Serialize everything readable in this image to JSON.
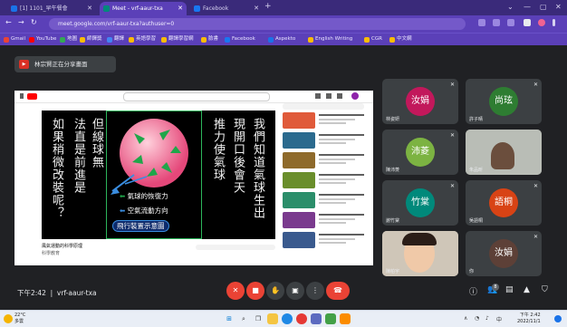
{
  "browser": {
    "tabs": [
      {
        "label": "[1] 1101_早午餐會",
        "active": false
      },
      {
        "label": "Meet - vrf-aaur-txa",
        "active": true
      },
      {
        "label": "Facebook",
        "active": false
      }
    ],
    "url": "meet.google.com/vrf-aaur-txa?authuser=0",
    "bookmarks": [
      "Gmail",
      "YouTube",
      "地圖",
      "師鐸獎",
      "翻譯",
      "英語學習",
      "翻譯學習網",
      "臉書",
      "Facebook",
      "Aspekto",
      "English Writing",
      "CGR",
      "中文網"
    ]
  },
  "meeting": {
    "host_label": "林宗賢正在分享畫面",
    "code": "vrf-aaur-txa",
    "time": "下午2:42"
  },
  "slide": {
    "col1": "如果稍微改裝呢？",
    "col2": "法直是前進是",
    "col3": "但線球無",
    "legend1": "氣球的恢復力",
    "legend2": "空氣流動方向",
    "legend3": "飛行裝置示意圖",
    "right1": "推力使氣球",
    "right2": "現開口後會天",
    "right3": "我們知道氣球生出"
  },
  "video": {
    "caption": "風氣運動的科學原理",
    "channel": "科學教育"
  },
  "participants": [
    {
      "name": "林姿妍",
      "avatar": "汝娟",
      "color": "#c2185b"
    },
    {
      "name": "許子晴",
      "avatar": "尚玹",
      "color": "#2e7d32"
    },
    {
      "name": "陳沛菱",
      "avatar": "沛菱",
      "color": "#7cb342"
    },
    {
      "name": "朱品昕",
      "avatar": "",
      "color": ""
    },
    {
      "name": "謝竹棠",
      "avatar": "竹棠",
      "color": "#00897b"
    },
    {
      "name": "吳語桐",
      "avatar": "語桐",
      "color": "#d84315"
    },
    {
      "name": "陳柏宇",
      "avatar": "",
      "color": ""
    },
    {
      "name": "你",
      "avatar": "汝娟",
      "color": "#5d4037"
    }
  ],
  "taskbar": {
    "weather_temp": "22°C",
    "weather_desc": "多雲",
    "time": "下午 2:42",
    "date": "2022/11/1"
  },
  "colors": {
    "browser_purple": "#5b40b8",
    "meet_background": "#202124",
    "hangup_red": "#ea4335"
  }
}
